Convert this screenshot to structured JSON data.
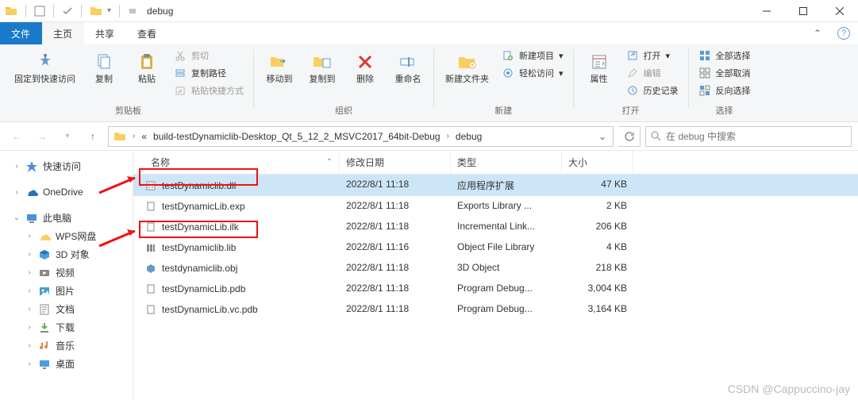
{
  "window": {
    "title": "debug",
    "qat_icons": [
      "folder",
      "check",
      "folder",
      "eq"
    ]
  },
  "tabs": {
    "file": "文件",
    "home": "主页",
    "share": "共享",
    "view": "查看"
  },
  "ribbon": {
    "pin": "固定到快速访问",
    "copy": "复制",
    "paste": "粘贴",
    "cut": "剪切",
    "copy_path": "复制路径",
    "paste_shortcut": "粘贴快捷方式",
    "group_clipboard": "剪贴板",
    "move_to": "移动到",
    "copy_to": "复制到",
    "delete": "删除",
    "rename": "重命名",
    "group_organize": "组织",
    "new_folder": "新建文件夹",
    "new_item": "新建项目",
    "easy_access": "轻松访问",
    "group_new": "新建",
    "properties": "属性",
    "open": "打开",
    "edit": "编辑",
    "history": "历史记录",
    "group_open": "打开",
    "select_all": "全部选择",
    "select_none": "全部取消",
    "invert_sel": "反向选择",
    "group_select": "选择"
  },
  "addressbar": {
    "crumbs": [
      "build-testDynamiclib-Desktop_Qt_5_12_2_MSVC2017_64bit-Debug",
      "debug"
    ],
    "search_placeholder": "在 debug 中搜索"
  },
  "nav": {
    "quick": "快速访问",
    "onedrive": "OneDrive",
    "thispc": "此电脑",
    "wps": "WPS网盘",
    "3d": "3D 对象",
    "videos": "视频",
    "pictures": "图片",
    "documents": "文档",
    "downloads": "下载",
    "music": "音乐",
    "desktop": "桌面"
  },
  "columns": {
    "name": "名称",
    "date": "修改日期",
    "type": "类型",
    "size": "大小"
  },
  "files": [
    {
      "name": "testDynamiclib.dll",
      "date": "2022/8/1 11:18",
      "type": "应用程序扩展",
      "size": "47 KB",
      "selected": true,
      "highlight": true,
      "icon": "dll"
    },
    {
      "name": "testDynamicLib.exp",
      "date": "2022/8/1 11:18",
      "type": "Exports Library ...",
      "size": "2 KB",
      "icon": "file"
    },
    {
      "name": "testDynamicLib.ilk",
      "date": "2022/8/1 11:18",
      "type": "Incremental Link...",
      "size": "206 KB",
      "icon": "file"
    },
    {
      "name": "testDynamiclib.lib",
      "date": "2022/8/1 11:16",
      "type": "Object File Library",
      "size": "4 KB",
      "highlight": true,
      "icon": "lib"
    },
    {
      "name": "testdynamiclib.obj",
      "date": "2022/8/1 11:18",
      "type": "3D Object",
      "size": "218 KB",
      "icon": "obj"
    },
    {
      "name": "testDynamicLib.pdb",
      "date": "2022/8/1 11:18",
      "type": "Program Debug...",
      "size": "3,004 KB",
      "icon": "file"
    },
    {
      "name": "testDynamicLib.vc.pdb",
      "date": "2022/8/1 11:18",
      "type": "Program Debug...",
      "size": "3,164 KB",
      "icon": "file"
    }
  ],
  "watermark": "CSDN @Cappuccino-jay"
}
